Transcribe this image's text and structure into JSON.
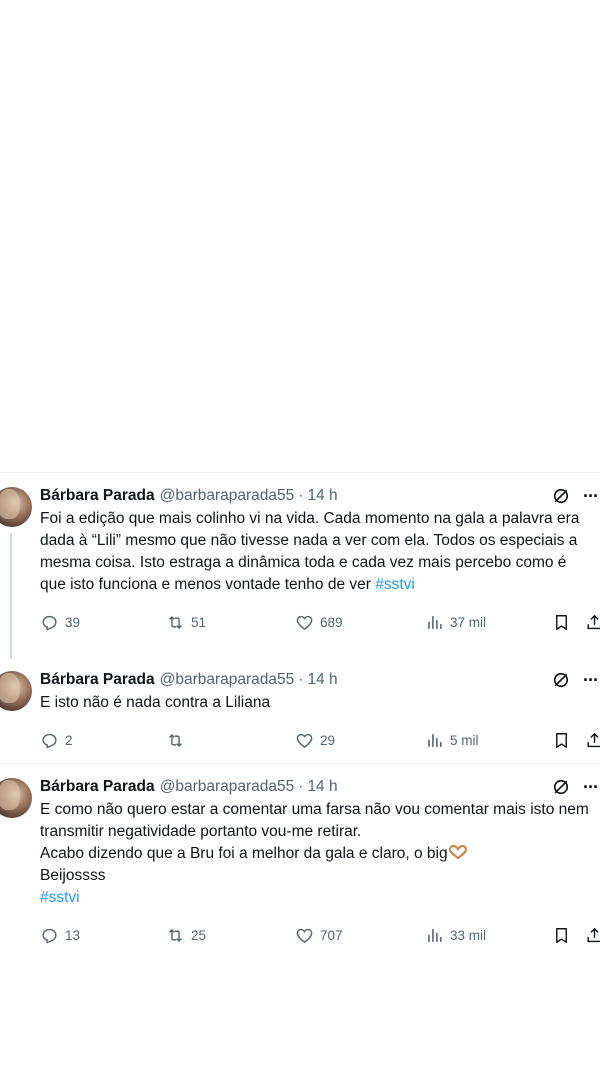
{
  "tweets": [
    {
      "name": "Bárbara Parada",
      "handle": "@barbaraparada55",
      "separator": "·",
      "time": "14 h",
      "text": "Foi a edição que mais colinho vi na vida. Cada momento na gala a palavra era dada à “Lili” mesmo que não tivesse nada a ver com ela. Todos os especiais a mesma coisa. Isto estraga a dinâmica toda e cada vez mais percebo como é que isto funciona e menos vontade tenho de ver ",
      "hashtag": "#sstvi",
      "replies": "39",
      "retweets": "51",
      "likes": "689",
      "views": "37 mil"
    },
    {
      "name": "Bárbara Parada",
      "handle": "@barbaraparada55",
      "separator": "·",
      "time": "14 h",
      "text": "E isto não é nada contra a Liliana",
      "replies": "2",
      "retweets": "",
      "likes": "29",
      "views": "5 mil"
    },
    {
      "name": "Bárbara Parada",
      "handle": "@barbaraparada55",
      "separator": "·",
      "time": "14 h",
      "text": "E como não quero estar a comentar uma farsa não vou comentar mais isto nem transmitir negatividade portanto vou-me retirar.\nAcabo dizendo que a Bru foi a melhor da gala e claro, o big",
      "text_after": "Beijossss",
      "hashtag": "#sstvi",
      "replies": "13",
      "retweets": "25",
      "likes": "707",
      "views": "33 mil"
    }
  ],
  "icons": {
    "reply": "reply-icon",
    "retweet": "retweet-icon",
    "like": "heart-icon",
    "views": "views-icon",
    "bookmark": "bookmark-icon",
    "share": "share-icon",
    "grok": "grok-icon",
    "more": "more-icon",
    "emoji": "heart-hands-emoji"
  },
  "colors": {
    "hashtag": "#1d9bf0",
    "muted": "#536471",
    "text": "#0f1419"
  }
}
